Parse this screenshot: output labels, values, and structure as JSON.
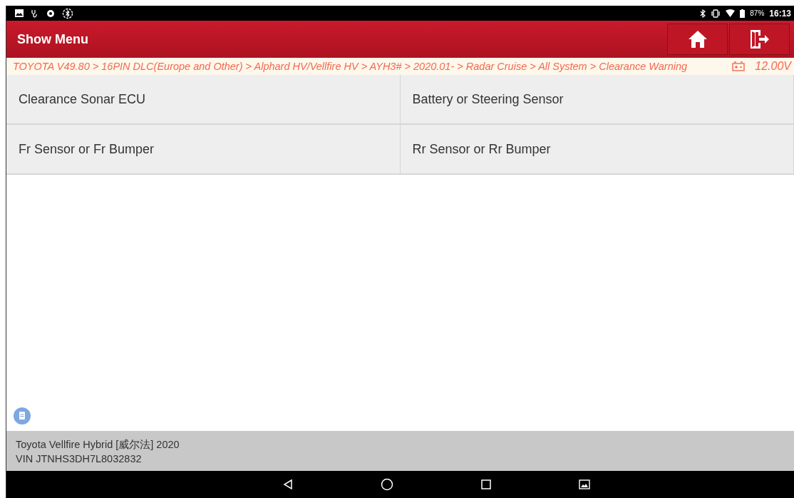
{
  "status_bar": {
    "battery": "87%",
    "time": "16:13"
  },
  "header": {
    "title": "Show Menu"
  },
  "breadcrumb": {
    "path": "TOYOTA V49.80 > 16PIN DLC(Europe and Other) > Alphard HV/Vellfire HV > AYH3# > 2020.01- > Radar Cruise > All System > Clearance Warning",
    "voltage": "12.00V"
  },
  "menu_items": [
    {
      "label": "Clearance Sonar ECU"
    },
    {
      "label": "Battery or Steering Sensor"
    },
    {
      "label": "Fr Sensor or Fr Bumper"
    },
    {
      "label": "Rr Sensor or Rr Bumper"
    }
  ],
  "footer": {
    "vehicle": "Toyota Vellfire Hybrid [威尔法] 2020",
    "vin": "VIN JTNHS3DH7L8032832"
  }
}
